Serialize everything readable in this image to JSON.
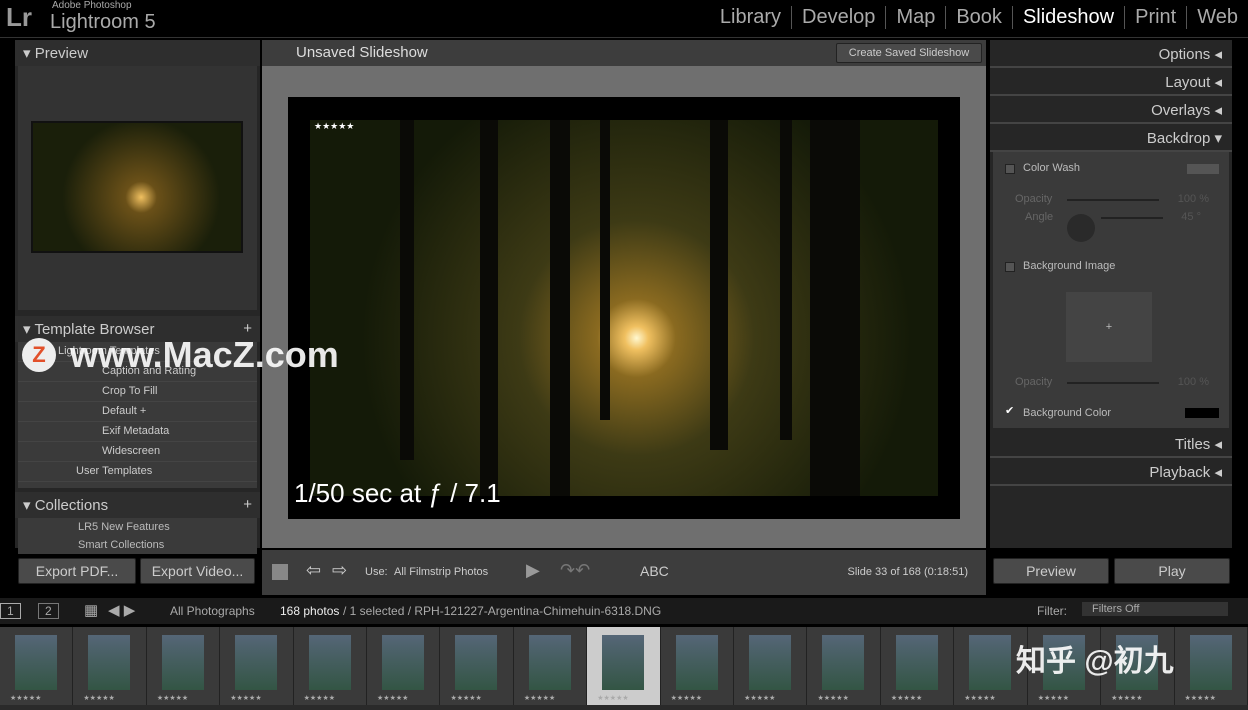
{
  "app": {
    "logo": "Lr",
    "vendor": "Adobe Photoshop",
    "product": "Lightroom 5"
  },
  "modules": [
    "Library",
    "Develop",
    "Map",
    "Book",
    "Slideshow",
    "Print",
    "Web"
  ],
  "active_module": "Slideshow",
  "left": {
    "preview": "Preview",
    "template_browser": "Template Browser",
    "lightroom_templates": "Lightroom Templates",
    "templates": [
      "Caption and Rating",
      "Crop To Fill",
      "Default +",
      "Exif Metadata",
      "Widescreen"
    ],
    "user_templates": "User Templates",
    "collections": "Collections",
    "collection_items": [
      "LR5 New Features",
      "Smart Collections"
    ],
    "export_pdf": "Export PDF...",
    "export_video": "Export Video..."
  },
  "center": {
    "title": "Unsaved Slideshow",
    "create_saved": "Create Saved Slideshow",
    "rating": "★★★★★",
    "caption": "1/50 sec at ƒ / 7.1",
    "use_label": "Use:",
    "use_value": "All Filmstrip Photos",
    "abc": "ABC",
    "slide_info": "Slide 33 of 168 (0:18:51)"
  },
  "right": {
    "sections": [
      "Options",
      "Layout",
      "Overlays",
      "Backdrop"
    ],
    "color_wash": "Color Wash",
    "opacity": "Opacity",
    "opacity_value": "100 %",
    "angle": "Angle",
    "angle_value": "45 °",
    "background_image": "Background Image",
    "bg_opacity_value": "100 %",
    "background_color": "Background Color",
    "background_color_hex": "#000000",
    "background_color_checked": true,
    "titles": "Titles",
    "playback": "Playback",
    "preview_btn": "Preview",
    "play_btn": "Play"
  },
  "filmstrip": {
    "view1": "1",
    "view2": "2",
    "source": "All Photographs",
    "count": "168 photos",
    "selection": " / 1 selected / RPH-121227-Argentina-Chimehuin-6318.DNG",
    "filter_label": "Filter:",
    "filter_value": "Filters Off",
    "stars": "★★★★★"
  },
  "watermarks": {
    "macz": "www.MacZ.com",
    "zhihu": "知乎 @初九"
  }
}
